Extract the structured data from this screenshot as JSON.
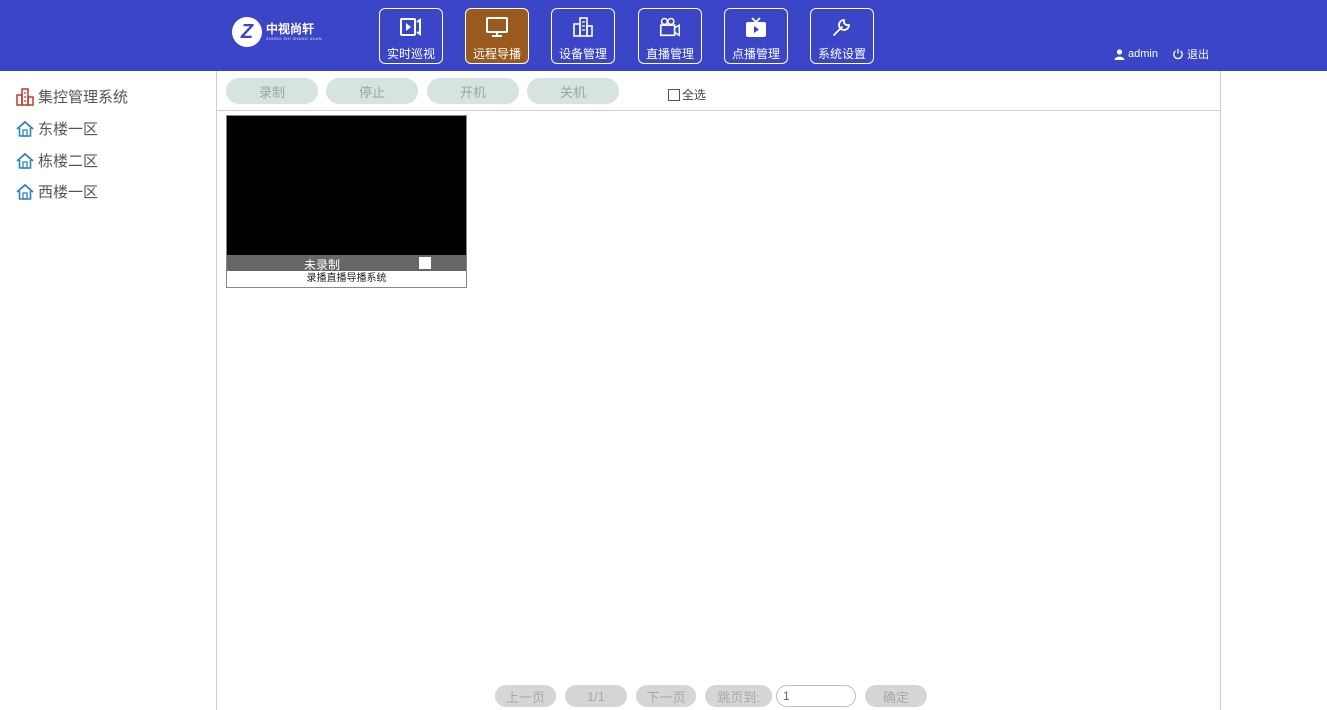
{
  "header": {
    "logo": {
      "name_cn": "中视尚轩",
      "name_en": "ZHONG SHI SHANG XUAN"
    },
    "nav": [
      {
        "label": "实时巡视",
        "icon": "video-play-icon",
        "active": false
      },
      {
        "label": "远程导播",
        "icon": "monitor-icon",
        "active": true
      },
      {
        "label": "设备管理",
        "icon": "building-icon",
        "active": false
      },
      {
        "label": "直播管理",
        "icon": "camera-icon",
        "active": false
      },
      {
        "label": "点播管理",
        "icon": "tv-play-icon",
        "active": false
      },
      {
        "label": "系统设置",
        "icon": "wrench-icon",
        "active": false
      }
    ],
    "user": {
      "name": "admin",
      "logout": "退出",
      "user_icon": "user-icon",
      "logout_icon": "power-icon"
    },
    "colors": {
      "bar": "#3a45c8",
      "active_nav": "#9a5a1e"
    }
  },
  "sidebar": {
    "items": [
      {
        "label": "集控管理系统",
        "icon": "building-icon",
        "color": "#c0392b"
      },
      {
        "label": "东楼一区",
        "icon": "home-icon",
        "color": "#2e86c1"
      },
      {
        "label": "栋楼二区",
        "icon": "home-icon",
        "color": "#2e86c1"
      },
      {
        "label": "西楼一区",
        "icon": "home-icon",
        "color": "#2e86c1"
      }
    ]
  },
  "toolbar": {
    "buttons": [
      "录制",
      "停止",
      "开机",
      "关机"
    ],
    "select_all": "全选"
  },
  "devices": [
    {
      "status": "未录制",
      "name": "录播直播导播系统"
    }
  ],
  "pagination": {
    "prev": "上一页",
    "page": "1/1",
    "next": "下一页",
    "jump_label": "跳页到:",
    "jump_value": "1",
    "confirm": "确定"
  }
}
